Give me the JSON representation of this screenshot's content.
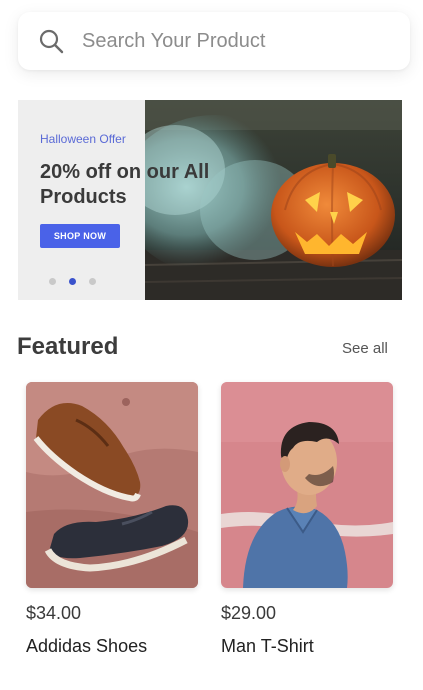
{
  "search": {
    "placeholder": "Search Your Product",
    "icon": "search-icon"
  },
  "banner": {
    "offer_label": "Halloween Offer",
    "title": "20% off on our All Products",
    "button_label": "SHOP NOW",
    "dots_count": 3,
    "active_dot": 1,
    "image": "halloween-pumpkin-photo"
  },
  "featured": {
    "title": "Featured",
    "see_all_label": "See all",
    "products": [
      {
        "price": "$34.00",
        "name": "Addidas Shoes",
        "image": "shoes-photo"
      },
      {
        "price": "$29.00",
        "name": "Man T-Shirt",
        "image": "man-shirt-photo"
      }
    ]
  },
  "colors": {
    "accent": "#4a62e8",
    "active_dot": "#3a52cc",
    "banner_bg": "#eeeeee"
  }
}
